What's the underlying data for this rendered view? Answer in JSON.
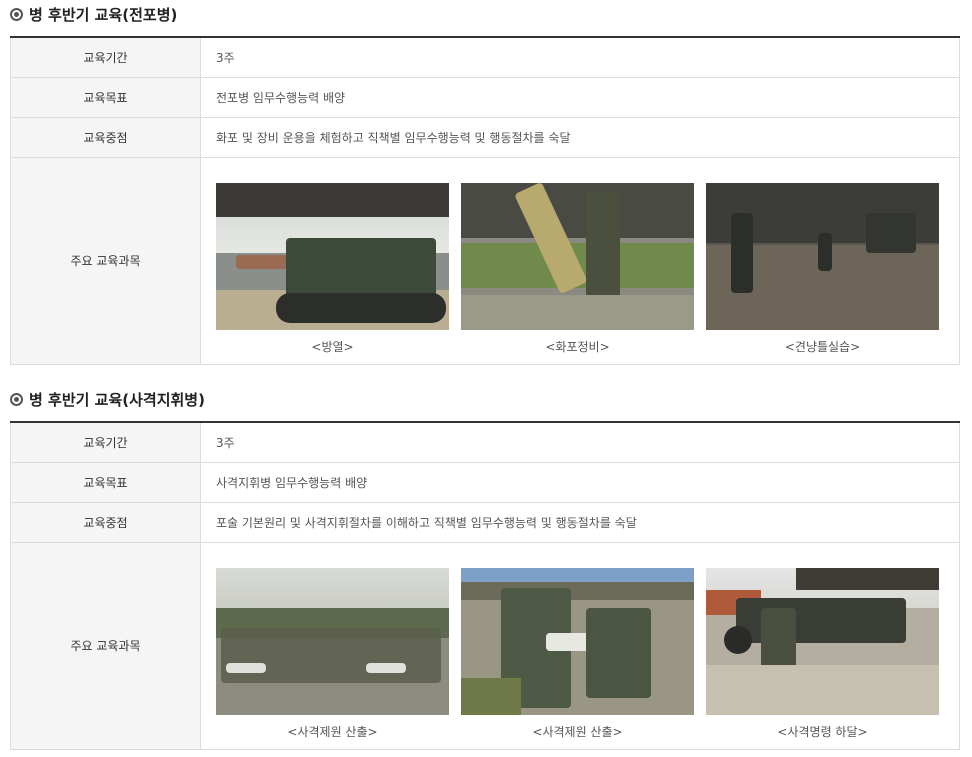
{
  "sections": [
    {
      "title": "병 후반기 교육(전포병)",
      "rows": [
        {
          "label": "교육기간",
          "value": "3주"
        },
        {
          "label": "교육목표",
          "value": "전포병 임무수행능력 배양"
        },
        {
          "label": "교육중점",
          "value": "화포 및 장비 운용을 체험하고 직책별 임무수행능력 및 행동절차를 숙달"
        }
      ],
      "subjects_label": "주요 교육과목",
      "photos": [
        {
          "caption": "<방열>"
        },
        {
          "caption": "<화포정비>"
        },
        {
          "caption": "<견냥틀실습>"
        }
      ]
    },
    {
      "title": "병 후반기 교육(사격지휘병)",
      "rows": [
        {
          "label": "교육기간",
          "value": "3주"
        },
        {
          "label": "교육목표",
          "value": "사격지휘병 임무수행능력 배양"
        },
        {
          "label": "교육중점",
          "value": "포술 기본원리 및 사격지휘절차를 이해하고 직책별 임무수행능력 및 행동절차를 숙달"
        }
      ],
      "subjects_label": "주요 교육과목",
      "photos": [
        {
          "caption": "<사격제원 산출>"
        },
        {
          "caption": "<사격제원 산출>"
        },
        {
          "caption": "<사격명령 하달>"
        }
      ]
    }
  ]
}
